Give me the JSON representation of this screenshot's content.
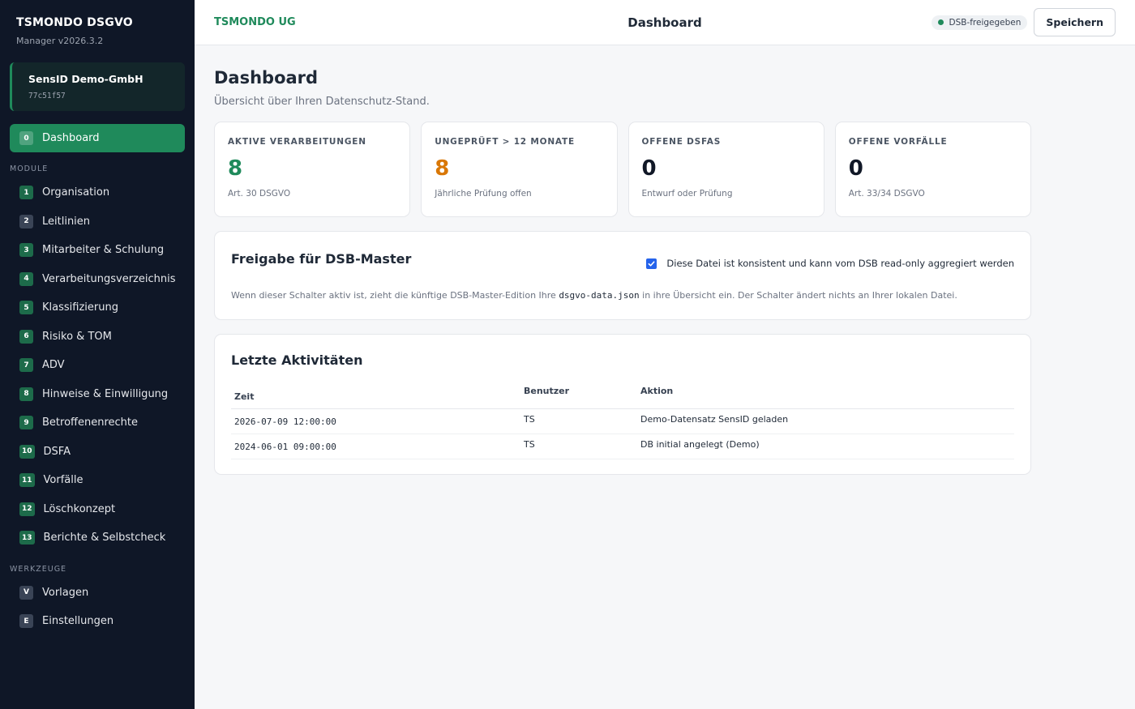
{
  "sidebar": {
    "brand_title": "TSMONDO DSGVO",
    "brand_sub": "Manager v2026.3.2",
    "tenant_name": "SensID Demo-GmbH",
    "tenant_id": "77c51f57",
    "active_item": {
      "num": "0",
      "label": "Dashboard"
    },
    "module_section": "MODULE",
    "modules": [
      {
        "num": "1",
        "label": "Organisation"
      },
      {
        "num": "2",
        "label": "Leitlinien"
      },
      {
        "num": "3",
        "label": "Mitarbeiter & Schulung"
      },
      {
        "num": "4",
        "label": "Verarbeitungsverzeichnis"
      },
      {
        "num": "5",
        "label": "Klassifizierung"
      },
      {
        "num": "6",
        "label": "Risiko & TOM"
      },
      {
        "num": "7",
        "label": "ADV"
      },
      {
        "num": "8",
        "label": "Hinweise & Einwilligung"
      },
      {
        "num": "9",
        "label": "Betroffenenrechte"
      },
      {
        "num": "10",
        "label": "DSFA"
      },
      {
        "num": "11",
        "label": "Vorfälle"
      },
      {
        "num": "12",
        "label": "Löschkonzept"
      },
      {
        "num": "13",
        "label": "Berichte & Selbstcheck"
      }
    ],
    "tools_section": "WERKZEUGE",
    "tools": [
      {
        "num": "V",
        "label": "Vorlagen"
      },
      {
        "num": "E",
        "label": "Einstellungen"
      }
    ]
  },
  "topbar": {
    "company": "TSMONDO UG",
    "title": "Dashboard",
    "badge": "DSB-freigegeben",
    "save_label": "Speichern"
  },
  "page": {
    "title": "Dashboard",
    "subtitle": "Übersicht über Ihren Datenschutz-Stand."
  },
  "stats": [
    {
      "label": "AKTIVE VERARBEITUNGEN",
      "value": "8",
      "note": "Art. 30 DSGVO",
      "color": "#1f8a5b"
    },
    {
      "label": "UNGEPRÜFT > 12 MONATE",
      "value": "8",
      "note": "Jährliche Prüfung offen",
      "color": "#d97706"
    },
    {
      "label": "OFFENE DSFAS",
      "value": "0",
      "note": "Entwurf oder Prüfung",
      "color": "#111827"
    },
    {
      "label": "OFFENE VORFÄLLE",
      "value": "0",
      "note": "Art. 33/34 DSGVO",
      "color": "#111827"
    }
  ],
  "release": {
    "title": "Freigabe für DSB-Master",
    "checkbox_label": "Diese Datei ist konsistent und kann vom DSB read-only aggregiert werden",
    "checked": true,
    "desc_before": "Wenn dieser Schalter aktiv ist, zieht die künftige DSB-Master-Edition Ihre ",
    "desc_file": "dsgvo-data.json",
    "desc_after": " in ihre Übersicht ein. Der Schalter ändert nichts an Ihrer lokalen Datei."
  },
  "activity": {
    "title": "Letzte Aktivitäten",
    "columns": [
      "Zeit",
      "Benutzer",
      "Aktion"
    ],
    "rows": [
      {
        "time": "2026-07-09 12:00:00",
        "user": "TS",
        "action": "Demo-Datensatz SensID geladen"
      },
      {
        "time": "2024-06-01 09:00:00",
        "user": "TS",
        "action": "DB initial angelegt (Demo)"
      }
    ]
  }
}
